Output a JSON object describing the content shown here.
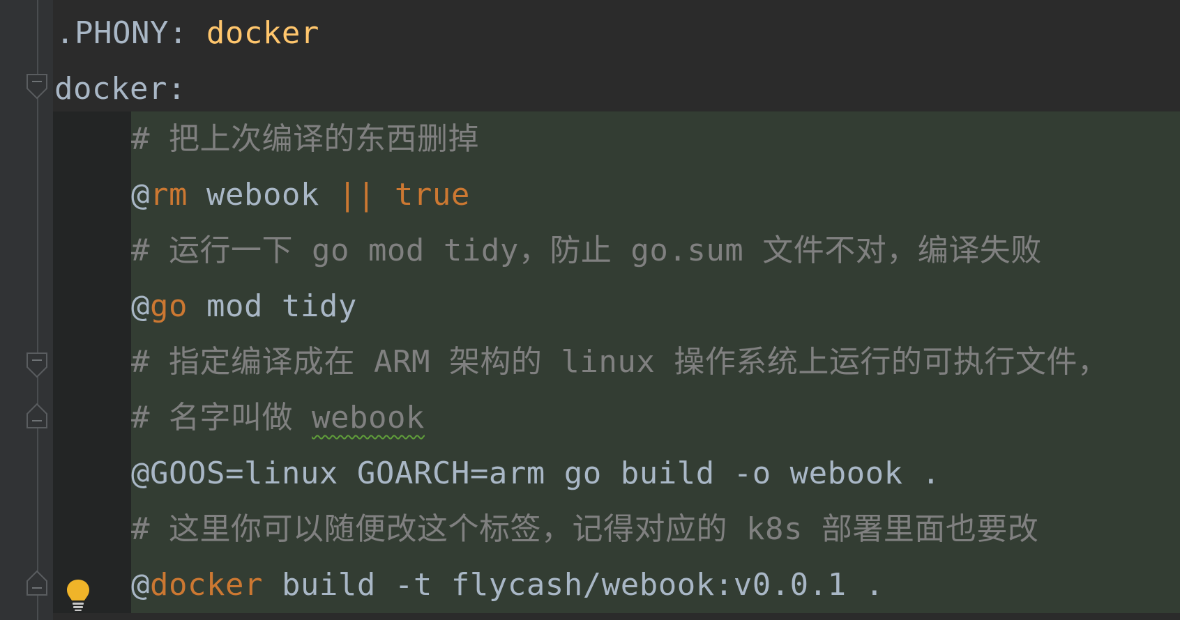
{
  "editor": {
    "lines": [
      {
        "parts": [
          ".PHONY: ",
          "docker"
        ]
      },
      {
        "parts": [
          "docker:"
        ]
      },
      {
        "parts": [
          "# 把上次编译的东西删掉"
        ]
      },
      {
        "parts": [
          "@",
          "rm",
          " webook ",
          "||",
          " ",
          "true"
        ]
      },
      {
        "parts": [
          "# 运行一下 go mod tidy，防止 go.sum 文件不对，编译失败"
        ]
      },
      {
        "parts": [
          "@",
          "go",
          " mod tidy"
        ]
      },
      {
        "parts": [
          "# 指定编译成在 ARM 架构的 linux 操作系统上运行的可执行文件，"
        ]
      },
      {
        "parts": [
          "# 名字叫做 ",
          "webook"
        ]
      },
      {
        "parts": [
          "@",
          "GOOS=linux GOARCH=arm go build -o webook ."
        ]
      },
      {
        "parts": [
          "# 这里你可以随便改这个标签，记得对应的 k8s 部署里面也要改"
        ]
      },
      {
        "parts": [
          "@",
          "docker",
          " build -t flycash/webook:v0.0.1 ."
        ]
      }
    ]
  },
  "colors": {
    "background": "#2b2b2b",
    "gutter": "#313335",
    "recipe_highlight": "#333d33",
    "default_text": "#a9b7c6",
    "keyword": "#cc7832",
    "target_name": "#ffc66d",
    "comment": "#808080",
    "typo_underline": "#5f9e3a",
    "bulb": "#f0b429"
  },
  "icons": [
    "fold-collapse-icon",
    "fold-end-icon",
    "lightbulb-icon"
  ]
}
